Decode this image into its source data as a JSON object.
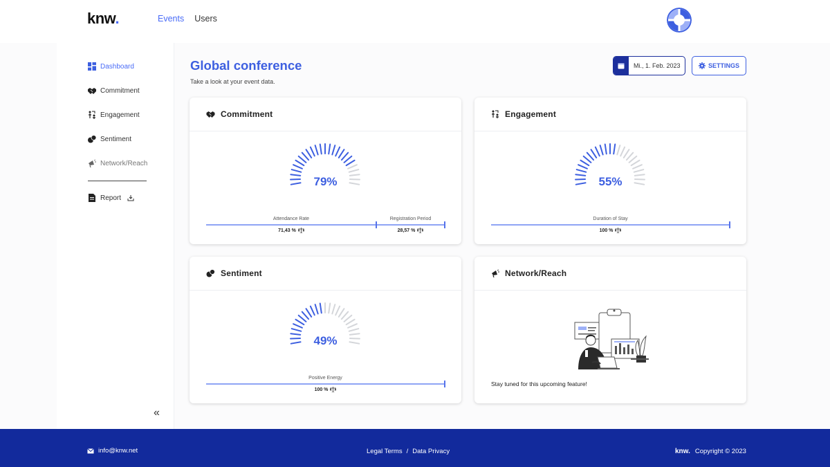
{
  "brand": {
    "logo_text": "knw",
    "logo_dot": "."
  },
  "topnav": {
    "events": "Events",
    "users": "Users"
  },
  "sidebar": {
    "items": [
      {
        "label": "Dashboard",
        "icon": "dashboard-icon"
      },
      {
        "label": "Commitment",
        "icon": "handshake-icon"
      },
      {
        "label": "Engagement",
        "icon": "engagement-icon"
      },
      {
        "label": "Sentiment",
        "icon": "sentiment-icon"
      },
      {
        "label": "Network/Reach",
        "icon": "megaphone-icon"
      }
    ],
    "report": "Report",
    "collapse": "«"
  },
  "header": {
    "title": "Global conference",
    "subtitle": "Take a look at your event data.",
    "date": "Mi., 1. Feb. 2023",
    "settings": "SETTINGS"
  },
  "cards": {
    "commitment": {
      "title": "Commitment",
      "gauge_value": 79,
      "gauge_text": "79%",
      "bars": [
        {
          "label": "Attendance Rate",
          "value": "71,43 %"
        },
        {
          "label": "Registration Period",
          "value": "28,57 %"
        }
      ]
    },
    "engagement": {
      "title": "Engagement",
      "gauge_value": 55,
      "gauge_text": "55%",
      "bars": [
        {
          "label": "Duration of Stay",
          "value": "100 %"
        }
      ]
    },
    "sentiment": {
      "title": "Sentiment",
      "gauge_value": 49,
      "gauge_text": "49%",
      "bars": [
        {
          "label": "Positive Energy",
          "value": "100 %"
        }
      ]
    },
    "network": {
      "title": "Network/Reach",
      "message": "Stay tuned for this upcoming feature!"
    }
  },
  "footer": {
    "email": "info@knw.net",
    "legal": "Legal Terms",
    "sep": "/",
    "privacy": "Data Privacy",
    "logo": "knw.",
    "copyright": "Copyright © 2023"
  },
  "colors": {
    "accent": "#3d5fe0",
    "dark_blue": "#122a9c",
    "gauge_inactive": "#d4d6da"
  }
}
